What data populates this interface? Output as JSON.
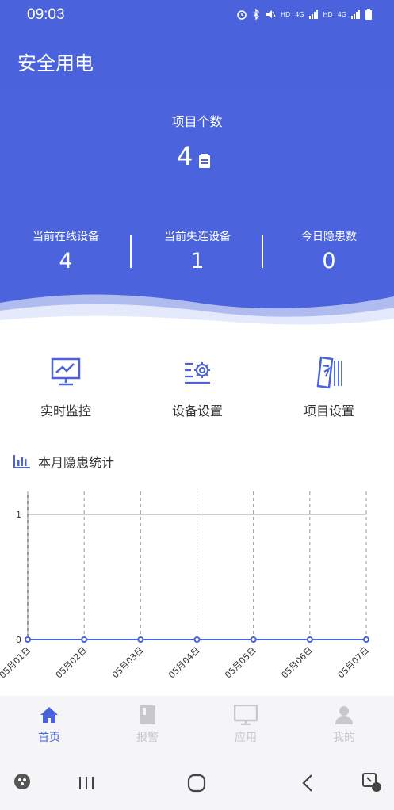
{
  "status_bar": {
    "time": "09:03",
    "icons": [
      "alarm-icon",
      "bluetooth-icon",
      "mute-icon",
      "signal-icon",
      "signal-icon",
      "battery-icon"
    ],
    "network_labels": [
      "HD",
      "4G",
      "HD",
      "4G"
    ]
  },
  "app_bar": {
    "title": "安全用电"
  },
  "summary": {
    "project_label": "项目个数",
    "project_count": "4",
    "stats": [
      {
        "label": "当前在线设备",
        "value": "4"
      },
      {
        "label": "当前失连设备",
        "value": "1"
      },
      {
        "label": "今日隐患数",
        "value": "0"
      }
    ]
  },
  "menu": [
    {
      "label": "实时监控",
      "icon": "monitor-chart-icon"
    },
    {
      "label": "设备设置",
      "icon": "device-settings-icon"
    },
    {
      "label": "项目设置",
      "icon": "project-settings-icon"
    }
  ],
  "section": {
    "title": "本月隐患统计",
    "icon": "bar-chart-icon"
  },
  "chart_data": {
    "type": "line",
    "title": "",
    "xlabel": "",
    "ylabel": "",
    "categories": [
      "05月01日",
      "05月02日",
      "05月03日",
      "05月04日",
      "05月05日",
      "05月06日",
      "05月07日"
    ],
    "series": [
      {
        "values": [
          0,
          0,
          0,
          0,
          0,
          0,
          0
        ]
      }
    ],
    "yticks": [
      "0",
      "1"
    ],
    "ylim": [
      0,
      1
    ],
    "color": "#4a63dc",
    "grid": true
  },
  "bottom_nav": [
    {
      "label": "首页",
      "icon": "home-icon",
      "active": true
    },
    {
      "label": "报警",
      "icon": "alarm-book-icon",
      "active": false
    },
    {
      "label": "应用",
      "icon": "monitor-icon",
      "active": false
    },
    {
      "label": "我的",
      "icon": "person-icon",
      "active": false
    }
  ],
  "colors": {
    "primary": "#4a63dc",
    "inactive": "#c8c8cc",
    "text": "#333333"
  }
}
